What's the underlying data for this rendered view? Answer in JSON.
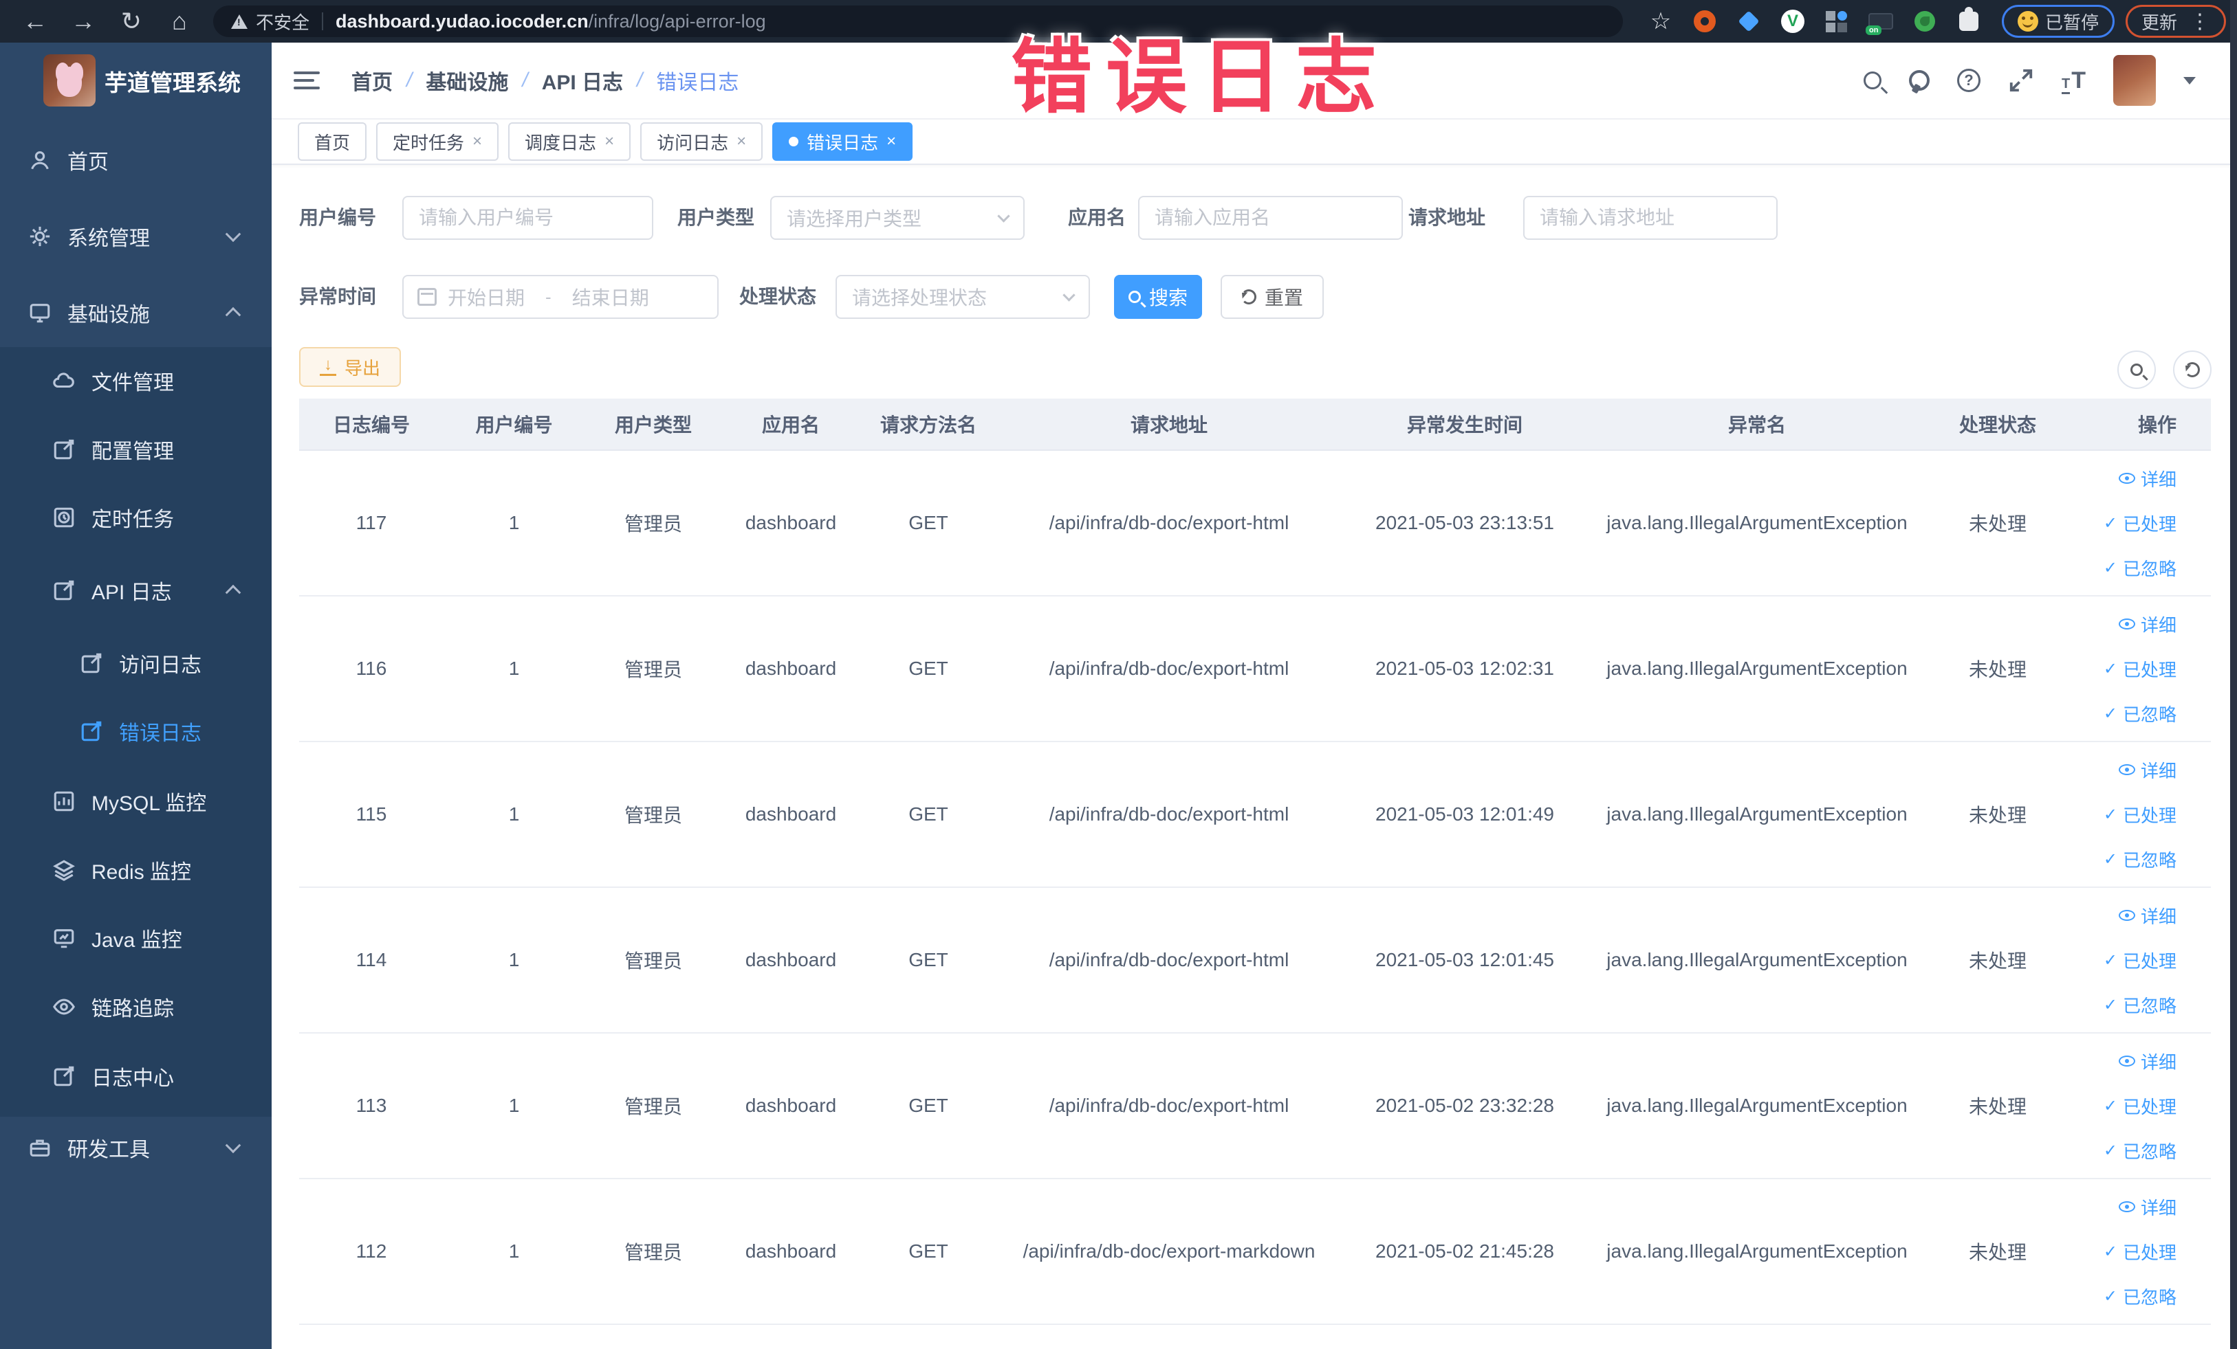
{
  "browser": {
    "security_label": "不安全",
    "url_domain": "dashboard.yudao.iocoder.cn",
    "url_path": "/infra/log/api-error-log",
    "paused_label": "已暂停",
    "update_label": "更新"
  },
  "annotation": {
    "text": "错误日志",
    "color": "#f2405c"
  },
  "sidebar": {
    "title": "芋道管理系统",
    "items": [
      {
        "label": "首页"
      },
      {
        "label": "系统管理",
        "chevron": "down"
      },
      {
        "label": "基础设施",
        "chevron": "up"
      },
      {
        "label": "文件管理"
      },
      {
        "label": "配置管理"
      },
      {
        "label": "定时任务"
      },
      {
        "label": "API 日志",
        "chevron": "up"
      },
      {
        "label": "访问日志"
      },
      {
        "label": "错误日志",
        "active": true
      },
      {
        "label": "MySQL 监控"
      },
      {
        "label": "Redis 监控"
      },
      {
        "label": "Java 监控"
      },
      {
        "label": "链路追踪"
      },
      {
        "label": "日志中心"
      },
      {
        "label": "研发工具",
        "chevron": "down"
      }
    ]
  },
  "header": {
    "breadcrumb": [
      "首页",
      "基础设施",
      "API 日志",
      "错误日志"
    ]
  },
  "tabs": [
    {
      "label": "首页",
      "closable": false,
      "active": false
    },
    {
      "label": "定时任务",
      "closable": true,
      "active": false
    },
    {
      "label": "调度日志",
      "closable": true,
      "active": false
    },
    {
      "label": "访问日志",
      "closable": true,
      "active": false
    },
    {
      "label": "错误日志",
      "closable": true,
      "active": true
    }
  ],
  "filters": {
    "user_id_label": "用户编号",
    "user_id_placeholder": "请输入用户编号",
    "user_type_label": "用户类型",
    "user_type_placeholder": "请选择用户类型",
    "app_name_label": "应用名",
    "app_name_placeholder": "请输入应用名",
    "request_url_label": "请求地址",
    "request_url_placeholder": "请输入请求地址",
    "exception_time_label": "异常时间",
    "date_start_placeholder": "开始日期",
    "date_separator": "-",
    "date_end_placeholder": "结束日期",
    "process_status_label": "处理状态",
    "process_status_placeholder": "请选择处理状态",
    "search_label": "搜索",
    "reset_label": "重置"
  },
  "toolbar": {
    "export_label": "导出"
  },
  "table": {
    "columns": [
      "日志编号",
      "用户编号",
      "用户类型",
      "应用名",
      "请求方法名",
      "请求地址",
      "异常发生时间",
      "异常名",
      "处理状态",
      "操作"
    ],
    "column_keys": [
      "id",
      "user_id",
      "user_type",
      "app",
      "method",
      "url",
      "time",
      "exception",
      "status"
    ],
    "row_actions": [
      "详细",
      "已处理",
      "已忽略"
    ],
    "rows": [
      {
        "id": "117",
        "user_id": "1",
        "user_type": "管理员",
        "app": "dashboard",
        "method": "GET",
        "url": "/api/infra/db-doc/export-html",
        "time": "2021-05-03 23:13:51",
        "exception": "java.lang.IllegalArgumentException",
        "status": "未处理"
      },
      {
        "id": "116",
        "user_id": "1",
        "user_type": "管理员",
        "app": "dashboard",
        "method": "GET",
        "url": "/api/infra/db-doc/export-html",
        "time": "2021-05-03 12:02:31",
        "exception": "java.lang.IllegalArgumentException",
        "status": "未处理"
      },
      {
        "id": "115",
        "user_id": "1",
        "user_type": "管理员",
        "app": "dashboard",
        "method": "GET",
        "url": "/api/infra/db-doc/export-html",
        "time": "2021-05-03 12:01:49",
        "exception": "java.lang.IllegalArgumentException",
        "status": "未处理"
      },
      {
        "id": "114",
        "user_id": "1",
        "user_type": "管理员",
        "app": "dashboard",
        "method": "GET",
        "url": "/api/infra/db-doc/export-html",
        "time": "2021-05-03 12:01:45",
        "exception": "java.lang.IllegalArgumentException",
        "status": "未处理"
      },
      {
        "id": "113",
        "user_id": "1",
        "user_type": "管理员",
        "app": "dashboard",
        "method": "GET",
        "url": "/api/infra/db-doc/export-html",
        "time": "2021-05-02 23:32:28",
        "exception": "java.lang.IllegalArgumentException",
        "status": "未处理"
      },
      {
        "id": "112",
        "user_id": "1",
        "user_type": "管理员",
        "app": "dashboard",
        "method": "GET",
        "url": "/api/infra/db-doc/export-markdown",
        "time": "2021-05-02 21:45:28",
        "exception": "java.lang.IllegalArgumentException",
        "status": "未处理"
      }
    ]
  },
  "icons": {
    "security": "warning-triangle",
    "search": "magnifier",
    "refresh": "circular-arrow",
    "export": "download-arrow",
    "detail": "eye",
    "processed": "check",
    "ignored": "check",
    "date": "calendar",
    "fullscreen": "expand-arrows",
    "help": "question-circle",
    "repo": "github-ring",
    "font_size": "Tt"
  },
  "colors": {
    "accent": "#409eff",
    "warning": "#e6a23c",
    "annotation": "#f2405c",
    "sidebar": "#2d4868"
  }
}
